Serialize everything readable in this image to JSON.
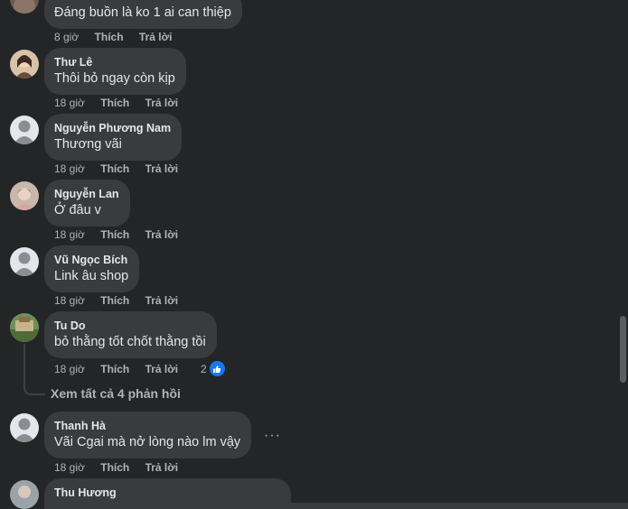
{
  "comments": [
    {
      "author": "",
      "text": "Đáng buồn là ko 1 ai can thiệp",
      "time": "8 giờ",
      "like": "Thích",
      "reply": "Trả lời"
    },
    {
      "author": "Thư Lê",
      "text": "Thôi bỏ ngay còn kịp",
      "time": "18 giờ",
      "like": "Thích",
      "reply": "Trả lời"
    },
    {
      "author": "Nguyễn Phương Nam",
      "text": "Thương vãi",
      "time": "18 giờ",
      "like": "Thích",
      "reply": "Trả lời"
    },
    {
      "author": "Nguyễn Lan",
      "text": "Ở đâu v",
      "time": "18 giờ",
      "like": "Thích",
      "reply": "Trả lời"
    },
    {
      "author": "Vũ Ngọc Bích",
      "text": "Link âu shop",
      "time": "18 giờ",
      "like": "Thích",
      "reply": "Trả lời"
    },
    {
      "author": "Tu Do",
      "text": "bỏ thằng tốt chốt thằng tồi",
      "time": "18 giờ",
      "like": "Thích",
      "reply": "Trả lời",
      "reactions": "2"
    },
    {
      "author": "Thanh Hà",
      "text": "Vãi Cgai mà nở lòng nào lm vậy",
      "time": "18 giờ",
      "like": "Thích",
      "reply": "Trả lời"
    },
    {
      "author": "Thu Hương"
    }
  ],
  "view_replies": "Xem tất cả 4 phản hồi",
  "more_menu": "···",
  "colors": {
    "background": "#242526",
    "bubble": "#3a3b3c",
    "meta": "#b0b3b8",
    "like": "#1877f2"
  }
}
